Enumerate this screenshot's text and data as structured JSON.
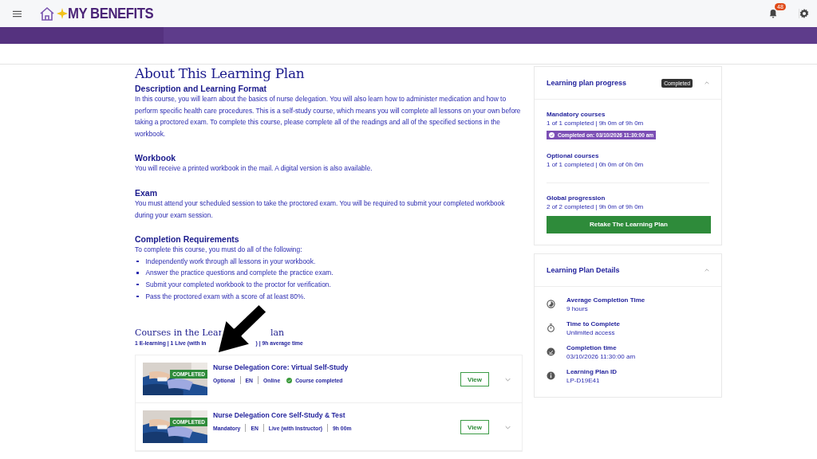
{
  "header": {
    "logo_text": "MY BENEFITS",
    "notification_count": "48"
  },
  "about": {
    "title": "About This Learning Plan",
    "sections": [
      {
        "heading": "Description and Learning Format",
        "text": "In this course, you will learn about the basics of nurse delegation. You will also learn how to administer medication and how to perform specific health care procedures. This is a self-study course, which means you will complete all lessons on your own before taking a proctored exam. To complete this course, please complete all of the readings and all of the specified sections in the workbook."
      },
      {
        "heading": "Workbook",
        "text": "You will receive a printed workbook in the mail. A digital version is also available."
      },
      {
        "heading": "Exam",
        "text": "You must attend your scheduled session to take the proctored exam. You will be required to submit your completed workbook during your exam session."
      },
      {
        "heading": "Completion Requirements",
        "text": "To complete this course, you must do all of the following:",
        "bullets": [
          "Independently work through all lessons in your workbook.",
          "Answer the practice questions and complete the practice exam.",
          "Submit your completed workbook to the proctor for verification.",
          "Pass the proctored exam with a score of at least 80%."
        ]
      }
    ]
  },
  "courses": {
    "title_parts": [
      "Courses in the Lear",
      "lan"
    ],
    "summary_parts": [
      "1 E-learning | 1 Live (with In",
      ") | 9h average time"
    ],
    "items": [
      {
        "badge": "COMPLETED",
        "title": "Nurse Delegation Core: Virtual Self-Study",
        "meta": [
          "Optional",
          "EN",
          "Online"
        ],
        "status": "Course completed",
        "button": "View"
      },
      {
        "badge": "COMPLETED",
        "title": "Nurse Delegation Core Self-Study & Test",
        "meta": [
          "Mandatory",
          "EN",
          "Live (with Instructor)",
          "9h 00m"
        ],
        "button": "View"
      }
    ]
  },
  "progress": {
    "title": "Learning plan progress",
    "badge": "Completed",
    "expanded": true,
    "groups": [
      {
        "label": "Mandatory courses",
        "value": "1 of 1 completed | 9h 0m of 9h 0m",
        "completed_on": "Completed on: 03/10/2026 11:30:00 am"
      },
      {
        "label": "Optional courses",
        "value": "1 of 1 completed | 0h 0m of 0h 0m"
      },
      {
        "label": "Global progression",
        "value": "2 of 2 completed | 9h 0m of 9h 0m"
      }
    ],
    "button": "Retake The Learning Plan"
  },
  "details": {
    "title": "Learning Plan Details",
    "expanded": true,
    "items": [
      {
        "kind": "average",
        "label": "Average Completion Time",
        "value": "9 hours"
      },
      {
        "kind": "timer",
        "label": "Time to Complete",
        "value": "Unlimited access"
      },
      {
        "kind": "completed",
        "label": "Completion time",
        "value": "03/10/2026 11:30:00 am"
      },
      {
        "kind": "info",
        "label": "Learning Plan ID",
        "value": "LP-D19E41"
      }
    ]
  }
}
